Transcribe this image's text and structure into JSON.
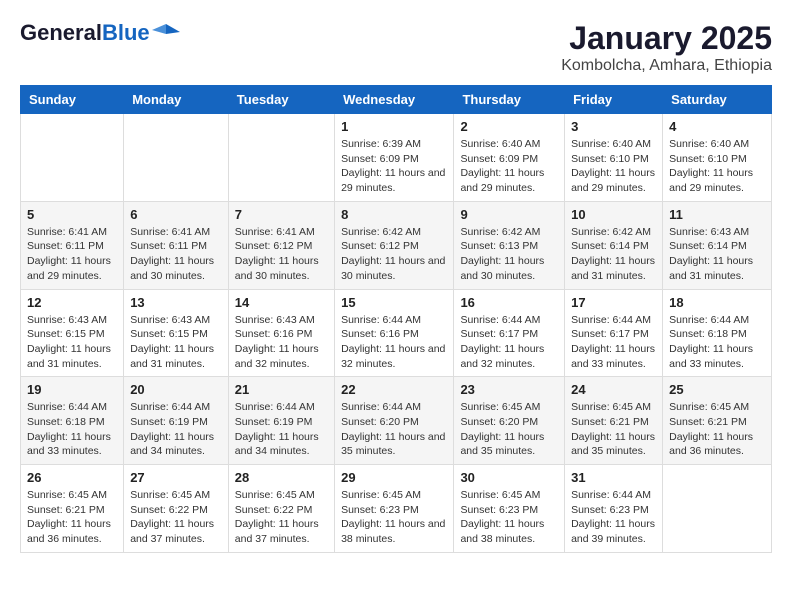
{
  "header": {
    "logo_general": "General",
    "logo_blue": "Blue",
    "title": "January 2025",
    "subtitle": "Kombolcha, Amhara, Ethiopia"
  },
  "days_of_week": [
    "Sunday",
    "Monday",
    "Tuesday",
    "Wednesday",
    "Thursday",
    "Friday",
    "Saturday"
  ],
  "weeks": [
    [
      {
        "day": "",
        "sunrise": "",
        "sunset": "",
        "daylight": ""
      },
      {
        "day": "",
        "sunrise": "",
        "sunset": "",
        "daylight": ""
      },
      {
        "day": "",
        "sunrise": "",
        "sunset": "",
        "daylight": ""
      },
      {
        "day": "1",
        "sunrise": "Sunrise: 6:39 AM",
        "sunset": "Sunset: 6:09 PM",
        "daylight": "Daylight: 11 hours and 29 minutes."
      },
      {
        "day": "2",
        "sunrise": "Sunrise: 6:40 AM",
        "sunset": "Sunset: 6:09 PM",
        "daylight": "Daylight: 11 hours and 29 minutes."
      },
      {
        "day": "3",
        "sunrise": "Sunrise: 6:40 AM",
        "sunset": "Sunset: 6:10 PM",
        "daylight": "Daylight: 11 hours and 29 minutes."
      },
      {
        "day": "4",
        "sunrise": "Sunrise: 6:40 AM",
        "sunset": "Sunset: 6:10 PM",
        "daylight": "Daylight: 11 hours and 29 minutes."
      }
    ],
    [
      {
        "day": "5",
        "sunrise": "Sunrise: 6:41 AM",
        "sunset": "Sunset: 6:11 PM",
        "daylight": "Daylight: 11 hours and 29 minutes."
      },
      {
        "day": "6",
        "sunrise": "Sunrise: 6:41 AM",
        "sunset": "Sunset: 6:11 PM",
        "daylight": "Daylight: 11 hours and 30 minutes."
      },
      {
        "day": "7",
        "sunrise": "Sunrise: 6:41 AM",
        "sunset": "Sunset: 6:12 PM",
        "daylight": "Daylight: 11 hours and 30 minutes."
      },
      {
        "day": "8",
        "sunrise": "Sunrise: 6:42 AM",
        "sunset": "Sunset: 6:12 PM",
        "daylight": "Daylight: 11 hours and 30 minutes."
      },
      {
        "day": "9",
        "sunrise": "Sunrise: 6:42 AM",
        "sunset": "Sunset: 6:13 PM",
        "daylight": "Daylight: 11 hours and 30 minutes."
      },
      {
        "day": "10",
        "sunrise": "Sunrise: 6:42 AM",
        "sunset": "Sunset: 6:14 PM",
        "daylight": "Daylight: 11 hours and 31 minutes."
      },
      {
        "day": "11",
        "sunrise": "Sunrise: 6:43 AM",
        "sunset": "Sunset: 6:14 PM",
        "daylight": "Daylight: 11 hours and 31 minutes."
      }
    ],
    [
      {
        "day": "12",
        "sunrise": "Sunrise: 6:43 AM",
        "sunset": "Sunset: 6:15 PM",
        "daylight": "Daylight: 11 hours and 31 minutes."
      },
      {
        "day": "13",
        "sunrise": "Sunrise: 6:43 AM",
        "sunset": "Sunset: 6:15 PM",
        "daylight": "Daylight: 11 hours and 31 minutes."
      },
      {
        "day": "14",
        "sunrise": "Sunrise: 6:43 AM",
        "sunset": "Sunset: 6:16 PM",
        "daylight": "Daylight: 11 hours and 32 minutes."
      },
      {
        "day": "15",
        "sunrise": "Sunrise: 6:44 AM",
        "sunset": "Sunset: 6:16 PM",
        "daylight": "Daylight: 11 hours and 32 minutes."
      },
      {
        "day": "16",
        "sunrise": "Sunrise: 6:44 AM",
        "sunset": "Sunset: 6:17 PM",
        "daylight": "Daylight: 11 hours and 32 minutes."
      },
      {
        "day": "17",
        "sunrise": "Sunrise: 6:44 AM",
        "sunset": "Sunset: 6:17 PM",
        "daylight": "Daylight: 11 hours and 33 minutes."
      },
      {
        "day": "18",
        "sunrise": "Sunrise: 6:44 AM",
        "sunset": "Sunset: 6:18 PM",
        "daylight": "Daylight: 11 hours and 33 minutes."
      }
    ],
    [
      {
        "day": "19",
        "sunrise": "Sunrise: 6:44 AM",
        "sunset": "Sunset: 6:18 PM",
        "daylight": "Daylight: 11 hours and 33 minutes."
      },
      {
        "day": "20",
        "sunrise": "Sunrise: 6:44 AM",
        "sunset": "Sunset: 6:19 PM",
        "daylight": "Daylight: 11 hours and 34 minutes."
      },
      {
        "day": "21",
        "sunrise": "Sunrise: 6:44 AM",
        "sunset": "Sunset: 6:19 PM",
        "daylight": "Daylight: 11 hours and 34 minutes."
      },
      {
        "day": "22",
        "sunrise": "Sunrise: 6:44 AM",
        "sunset": "Sunset: 6:20 PM",
        "daylight": "Daylight: 11 hours and 35 minutes."
      },
      {
        "day": "23",
        "sunrise": "Sunrise: 6:45 AM",
        "sunset": "Sunset: 6:20 PM",
        "daylight": "Daylight: 11 hours and 35 minutes."
      },
      {
        "day": "24",
        "sunrise": "Sunrise: 6:45 AM",
        "sunset": "Sunset: 6:21 PM",
        "daylight": "Daylight: 11 hours and 35 minutes."
      },
      {
        "day": "25",
        "sunrise": "Sunrise: 6:45 AM",
        "sunset": "Sunset: 6:21 PM",
        "daylight": "Daylight: 11 hours and 36 minutes."
      }
    ],
    [
      {
        "day": "26",
        "sunrise": "Sunrise: 6:45 AM",
        "sunset": "Sunset: 6:21 PM",
        "daylight": "Daylight: 11 hours and 36 minutes."
      },
      {
        "day": "27",
        "sunrise": "Sunrise: 6:45 AM",
        "sunset": "Sunset: 6:22 PM",
        "daylight": "Daylight: 11 hours and 37 minutes."
      },
      {
        "day": "28",
        "sunrise": "Sunrise: 6:45 AM",
        "sunset": "Sunset: 6:22 PM",
        "daylight": "Daylight: 11 hours and 37 minutes."
      },
      {
        "day": "29",
        "sunrise": "Sunrise: 6:45 AM",
        "sunset": "Sunset: 6:23 PM",
        "daylight": "Daylight: 11 hours and 38 minutes."
      },
      {
        "day": "30",
        "sunrise": "Sunrise: 6:45 AM",
        "sunset": "Sunset: 6:23 PM",
        "daylight": "Daylight: 11 hours and 38 minutes."
      },
      {
        "day": "31",
        "sunrise": "Sunrise: 6:44 AM",
        "sunset": "Sunset: 6:23 PM",
        "daylight": "Daylight: 11 hours and 39 minutes."
      },
      {
        "day": "",
        "sunrise": "",
        "sunset": "",
        "daylight": ""
      }
    ]
  ]
}
